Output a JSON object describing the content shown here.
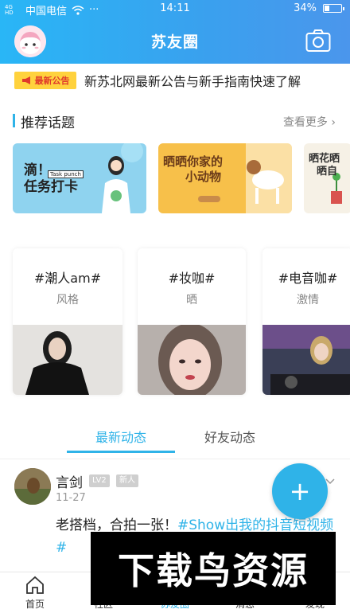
{
  "status_bar": {
    "network_small": "4G HD",
    "carrier": "中国电信",
    "time": "14:11",
    "battery": "34%",
    "battery_level": 0.34
  },
  "header": {
    "title": "苏友圈"
  },
  "notice": {
    "badge": "最新公告",
    "text": "新苏北网最新公告与新手指南快速了解"
  },
  "recommended": {
    "title": "推荐话题",
    "see_more": "查看更多",
    "cards": [
      {
        "line1": "滴！",
        "line2": "任务打卡",
        "small": "Task punch"
      },
      {
        "line1": "晒晒你家的",
        "line2": "小动物"
      },
      {
        "line1": "晒花晒",
        "line2": "晒自"
      }
    ]
  },
  "hot_topics": [
    {
      "title": "#潮人am#",
      "subtitle": "风格"
    },
    {
      "title": "#妆咖#",
      "subtitle": "晒"
    },
    {
      "title": "#电音咖#",
      "subtitle": "激情"
    }
  ],
  "tabs": {
    "latest": "最新动态",
    "friends": "好友动态"
  },
  "post": {
    "author": "言剑",
    "level": "LV2",
    "badge": "新人",
    "date": "11-27",
    "text": "老搭档，合拍一张！",
    "topic": "#Show出我的抖音短视频#"
  },
  "fab": {
    "label": "+"
  },
  "bottom_nav": [
    {
      "label": "首页"
    },
    {
      "label": "社区"
    },
    {
      "label": "苏友圈"
    },
    {
      "label": "消息"
    },
    {
      "label": "发现"
    }
  ],
  "watermark": "下载鸟资源",
  "colors": {
    "accent": "#2fb3e8",
    "header_start": "#29b6f6",
    "header_end": "#4b96ec",
    "notice_badge": "#ffd23d"
  }
}
